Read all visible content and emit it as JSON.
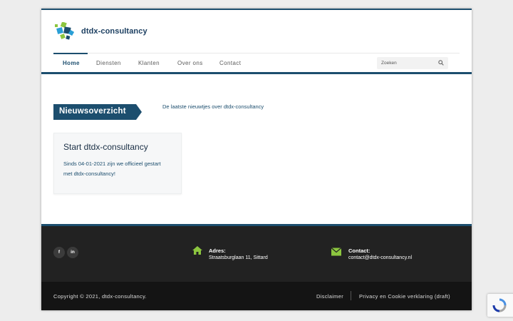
{
  "brand": {
    "name": "dtdx-consultancy"
  },
  "nav": {
    "items": [
      {
        "label": "Home",
        "active": true
      },
      {
        "label": "Diensten",
        "active": false
      },
      {
        "label": "Klanten",
        "active": false
      },
      {
        "label": "Over ons",
        "active": false
      },
      {
        "label": "Contact",
        "active": false
      }
    ],
    "search_placeholder": "Zoeken"
  },
  "main": {
    "section_title": "Nieuwsoverzicht",
    "section_description": "De laatste nieuwtjes over dtdx-consultancy",
    "posts": [
      {
        "title": "Start dtdx-consultancy",
        "excerpt": "Sinds 04-01-2021 zijn we officieel gestart met dtdx-consultancy!"
      }
    ]
  },
  "footer": {
    "social": [
      {
        "icon": "facebook-icon",
        "glyph": "f"
      },
      {
        "icon": "linkedin-icon",
        "glyph": "in"
      }
    ],
    "address": {
      "label": "Adres:",
      "value": "Straatsburglaan 11, Sittard"
    },
    "contact": {
      "label": "Contact:",
      "value": "contact@dtdx-consultancy.nl"
    },
    "copyright": "Copyright © 2021, dtdx-consultancy.",
    "links": [
      {
        "label": "Disclaimer"
      },
      {
        "label": "Privacy en Cookie verklaring (draft)"
      }
    ]
  },
  "colors": {
    "primary": "#1c4e6e",
    "accent_green": "#8cc63f",
    "footer_bg": "#222222",
    "bottom_bg": "#141414"
  }
}
